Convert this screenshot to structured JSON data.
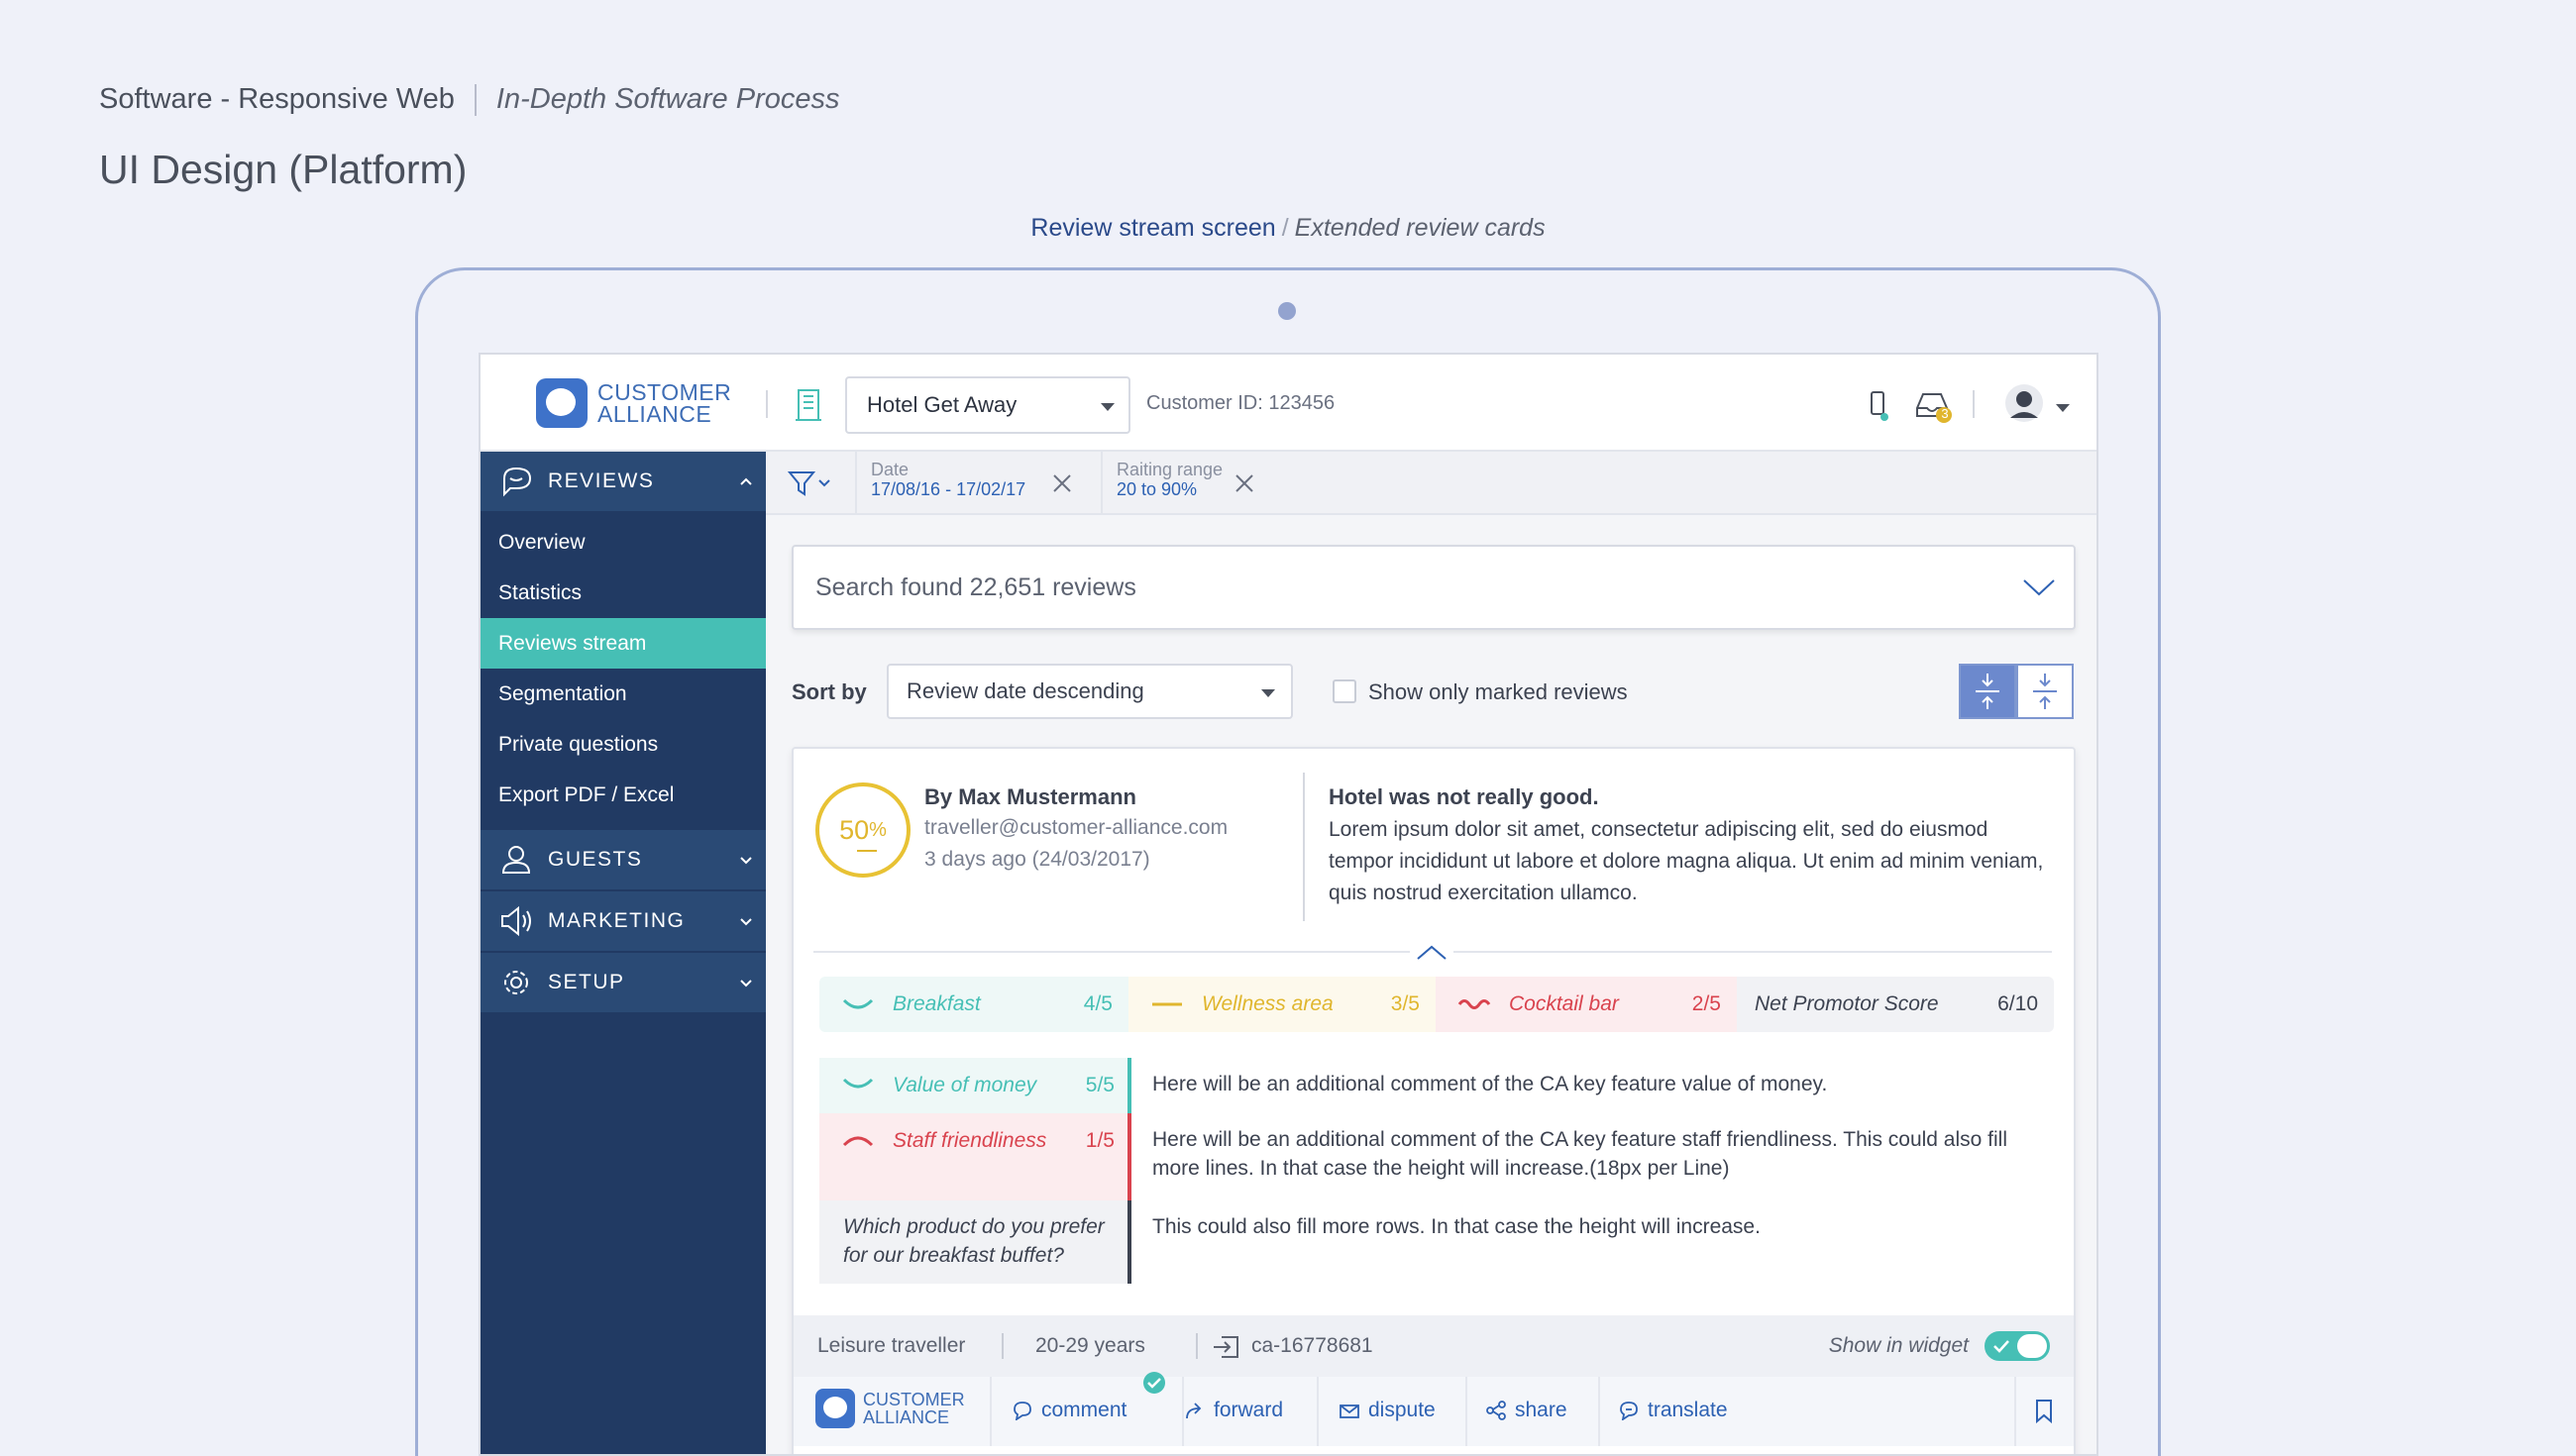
{
  "header": {
    "category": "Software - Responsive Web",
    "process": "In-Depth Software Process",
    "title": "UI Design (Platform)"
  },
  "caption": {
    "screen": "Review stream screen",
    "separator": "/",
    "variant": "Extended review cards"
  },
  "topbar": {
    "logo_line1": "CUSTOMER",
    "logo_line2": "ALLIANCE",
    "hotel": "Hotel Get Away",
    "customer_id": "Customer ID: 123456",
    "inbox_badge": "3"
  },
  "sidebar": {
    "reviews": "REVIEWS",
    "items": [
      "Overview",
      "Statistics",
      "Reviews stream",
      "Segmentation",
      "Private questions",
      "Export PDF / Excel"
    ],
    "guests": "GUESTS",
    "marketing": "MARKETING",
    "setup": "SETUP"
  },
  "filters": {
    "date_label": "Date",
    "date_value": "17/08/16 - 17/02/17",
    "rating_label": "Raiting range",
    "rating_value": "20 to 90%"
  },
  "search": {
    "text": "Search found 22,651 reviews"
  },
  "sort": {
    "label": "Sort by",
    "value": "Review date descending",
    "marked_label": "Show only marked reviews"
  },
  "review": {
    "score_num": "50",
    "score_unit": "%",
    "author": "By Max Mustermann",
    "email": "traveller@customer-alliance.com",
    "ago": "3 days ago (24/03/2017)",
    "title": "Hotel was not really good.",
    "body": "Lorem ipsum dolor sit amet, consectetur adipiscing elit, sed do eiusmod tempor incididunt ut labore et dolore magna aliqua. Ut enim ad minim veniam, quis nostrud exercitation ullamco.",
    "key_features": [
      {
        "name": "Breakfast",
        "value": "4/5",
        "mood": "positive"
      },
      {
        "name": "Wellness area",
        "value": "3/5",
        "mood": "neutral"
      },
      {
        "name": "Cocktail bar",
        "value": "2/5",
        "mood": "negative"
      },
      {
        "name": "Net Promotor Score",
        "value": "6/10",
        "mood": "none"
      }
    ],
    "details": [
      {
        "name": "Value of money",
        "value": "5/5",
        "mood": "positive",
        "comment": "Here will be an additional comment of the CA key feature value of money."
      },
      {
        "name": "Staff friendliness",
        "value": "1/5",
        "mood": "negative",
        "comment": "Here will be an additional comment of the CA key feature staff friendliness. This could also fill more lines. In that case the height will increase.(18px per Line)"
      },
      {
        "name": "Which product do you prefer for our breakfast buffet?",
        "value": "",
        "mood": "none",
        "comment": "This could also fill more rows. In that case the height will increase."
      }
    ],
    "meta": {
      "traveller": "Leisure traveller",
      "age": "20-29 years",
      "ref": "ca-16778681",
      "widget_label": "Show in widget"
    },
    "actions": {
      "source_line1": "CUSTOMER",
      "source_line2": "ALLIANCE",
      "comment": "comment",
      "forward": "forward",
      "dispute": "dispute",
      "share": "share",
      "translate": "translate"
    }
  },
  "colors": {
    "navy": "#213a63",
    "nav_section": "#2a4a75",
    "teal": "#46bfb5",
    "blue": "#2d61b3",
    "yellow": "#e0b62e",
    "red": "#d9434e"
  }
}
